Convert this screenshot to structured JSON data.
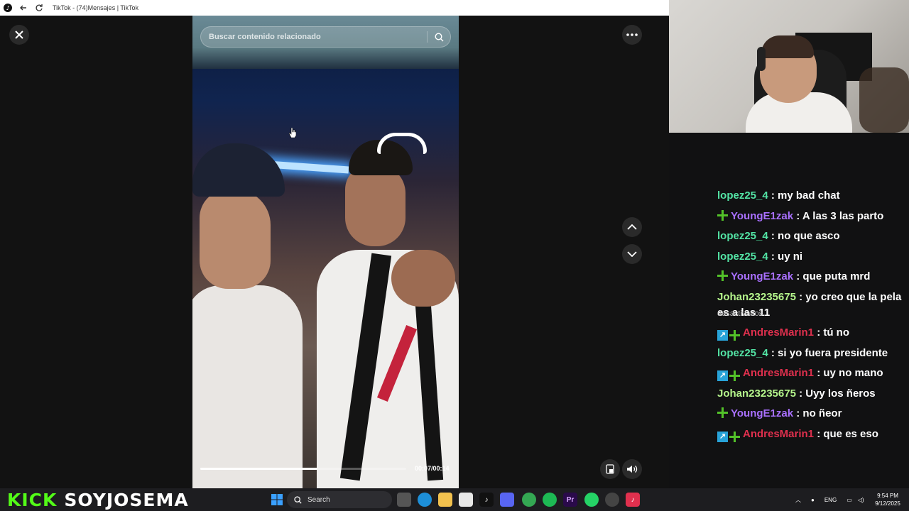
{
  "browser": {
    "title": "TikTok - (74)Mensajes | TikTok"
  },
  "viewer": {
    "search_placeholder": "Buscar contenido relacionado",
    "time_display": "00:07/00:14",
    "progress_fraction": 0.57
  },
  "chat": {
    "messages": [
      {
        "user": "lopez25_4",
        "color": "#53e4a5",
        "badges": [],
        "text": ": my bad chat"
      },
      {
        "user": "YoungE1zak",
        "color": "#a970ff",
        "badges": [
          "star"
        ],
        "text": ": A las 3 las parto"
      },
      {
        "user": "lopez25_4",
        "color": "#53e4a5",
        "badges": [],
        "text": ": no que asco"
      },
      {
        "user": "lopez25_4",
        "color": "#53e4a5",
        "badges": [],
        "text": ": uy ni"
      },
      {
        "user": "YoungE1zak",
        "color": "#a970ff",
        "badges": [
          "star"
        ],
        "text": ": que puta mrd"
      },
      {
        "user": "Johan23235675",
        "color": "#b5f58c",
        "badges": [],
        "text": ": yo creo que la pela es a las 11"
      },
      {
        "user": "AndresMarin1",
        "color": "#e0304e",
        "badges": [
          "up",
          "star"
        ],
        "text": ": tú no"
      },
      {
        "user": "lopez25_4",
        "color": "#53e4a5",
        "badges": [],
        "text": ": si yo fuera presidente"
      },
      {
        "user": "AndresMarin1",
        "color": "#e0304e",
        "badges": [
          "up",
          "star"
        ],
        "text": ": uy no mano"
      },
      {
        "user": "Johan23235675",
        "color": "#b5f58c",
        "badges": [],
        "text": ": Uyy los ñeros"
      },
      {
        "user": "YoungE1zak",
        "color": "#a970ff",
        "badges": [
          "star"
        ],
        "text": ": no ñeor"
      },
      {
        "user": "AndresMarin1",
        "color": "#e0304e",
        "badges": [
          "up",
          "star"
        ],
        "text": ": que es eso"
      }
    ],
    "overlay_note": "desactivados"
  },
  "branding": {
    "kick": "KICK",
    "channel": "SOYJOSEMA"
  },
  "taskbar": {
    "search_label": "Search",
    "language": "ENG",
    "time": "9:54 PM",
    "date": "9/12/2025",
    "apps": [
      "windows-start",
      "search",
      "task-view",
      "edge",
      "file-explorer",
      "store",
      "tiktok",
      "discord",
      "chrome",
      "spotify",
      "premiere",
      "whatsapp",
      "obs",
      "tiktok-live"
    ]
  },
  "colors": {
    "kick_green": "#53fc18",
    "accent_red": "#e0304e"
  }
}
